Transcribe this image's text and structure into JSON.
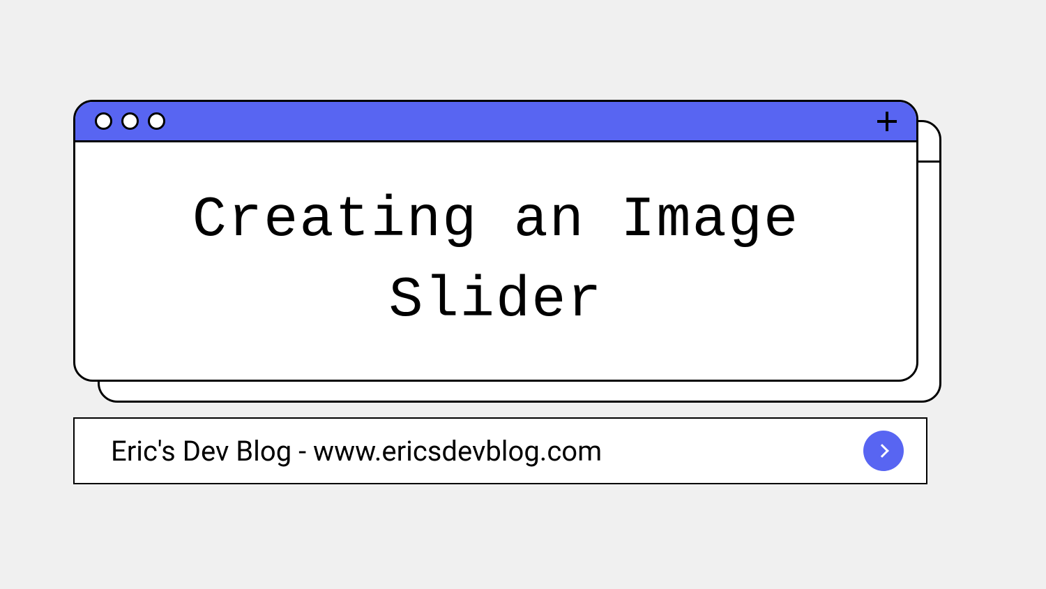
{
  "window": {
    "title": "Creating an Image Slider"
  },
  "addressBar": {
    "text": "Eric's Dev Blog - www.ericsdevblog.com"
  },
  "colors": {
    "accent": "#5865f2",
    "background": "#f0f0f0"
  }
}
